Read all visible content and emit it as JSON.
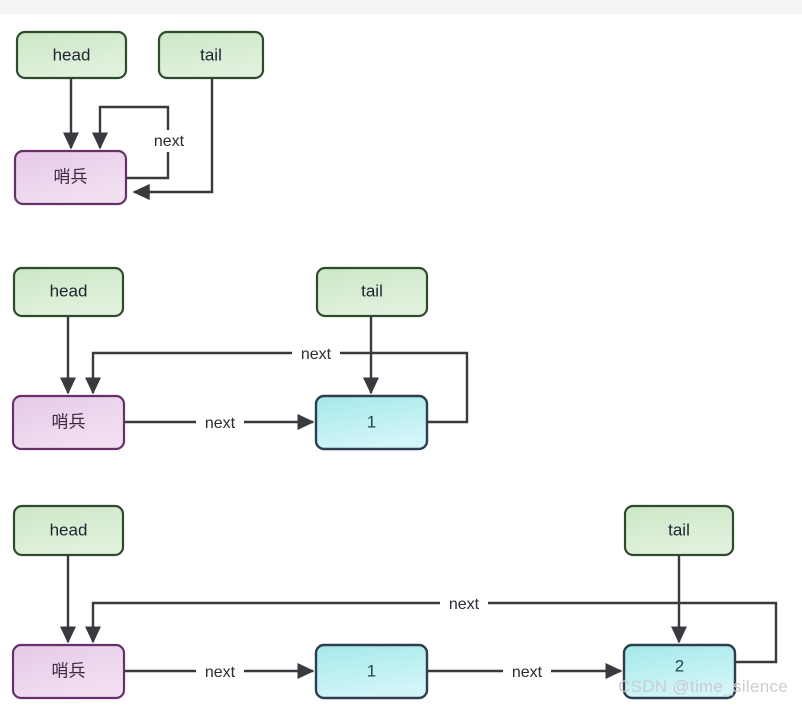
{
  "page": {
    "background_color": "#ffffff",
    "top_band_color": "#f5f5f7",
    "watermark": "CSDN @time_silence"
  },
  "palette": {
    "green_fill_start": "#cfe9cb",
    "green_fill_end": "#dff0da",
    "green_stroke": "#2e4c2b",
    "purple_fill_start": "#e8cde9",
    "purple_fill_end": "#f0dcf0",
    "purple_stroke": "#66316b",
    "blue_fill_start": "#a8eaea",
    "blue_fill_end": "#cdf4f7",
    "blue_stroke": "#2c3e50",
    "edge_stroke": "#39393f",
    "watermark_color": "#c9ccd1"
  },
  "diagrams": [
    {
      "id": "state-empty-list",
      "nodes": [
        {
          "id": "d1-head",
          "label": "head",
          "type": "pointer"
        },
        {
          "id": "d1-tail",
          "label": "tail",
          "type": "pointer"
        },
        {
          "id": "d1-sentinel",
          "label": "哨兵",
          "type": "sentinel"
        }
      ],
      "edges": [
        {
          "id": "d1-head-to-sentinel",
          "from": "head",
          "to": "哨兵",
          "label": ""
        },
        {
          "id": "d1-sentinel-self-next",
          "from": "哨兵",
          "to": "哨兵",
          "label": "next"
        },
        {
          "id": "d1-tail-to-sentinel",
          "from": "tail",
          "to": "哨兵",
          "label": ""
        }
      ]
    },
    {
      "id": "state-one-node",
      "nodes": [
        {
          "id": "d2-head",
          "label": "head",
          "type": "pointer"
        },
        {
          "id": "d2-tail",
          "label": "tail",
          "type": "pointer"
        },
        {
          "id": "d2-sentinel",
          "label": "哨兵",
          "type": "sentinel"
        },
        {
          "id": "d2-node1",
          "label": "1",
          "type": "data"
        }
      ],
      "edges": [
        {
          "id": "d2-head-to-sentinel",
          "from": "head",
          "to": "哨兵",
          "label": ""
        },
        {
          "id": "d2-sentinel-to-node1",
          "from": "哨兵",
          "to": "1",
          "label": "next"
        },
        {
          "id": "d2-node1-to-sentinel",
          "from": "1",
          "to": "哨兵",
          "label": "next"
        },
        {
          "id": "d2-tail-to-node1",
          "from": "tail",
          "to": "1",
          "label": ""
        }
      ]
    },
    {
      "id": "state-two-nodes",
      "nodes": [
        {
          "id": "d3-head",
          "label": "head",
          "type": "pointer"
        },
        {
          "id": "d3-tail",
          "label": "tail",
          "type": "pointer"
        },
        {
          "id": "d3-sentinel",
          "label": "哨兵",
          "type": "sentinel"
        },
        {
          "id": "d3-node1",
          "label": "1",
          "type": "data"
        },
        {
          "id": "d3-node2",
          "label": "2",
          "type": "data"
        }
      ],
      "edges": [
        {
          "id": "d3-head-to-sentinel",
          "from": "head",
          "to": "哨兵",
          "label": ""
        },
        {
          "id": "d3-sentinel-to-node1",
          "from": "哨兵",
          "to": "1",
          "label": "next"
        },
        {
          "id": "d3-node1-to-node2",
          "from": "1",
          "to": "2",
          "label": "next"
        },
        {
          "id": "d3-node2-to-sentinel",
          "from": "2",
          "to": "哨兵",
          "label": "next"
        },
        {
          "id": "d3-tail-to-node2",
          "from": "tail",
          "to": "2",
          "label": ""
        }
      ]
    }
  ]
}
